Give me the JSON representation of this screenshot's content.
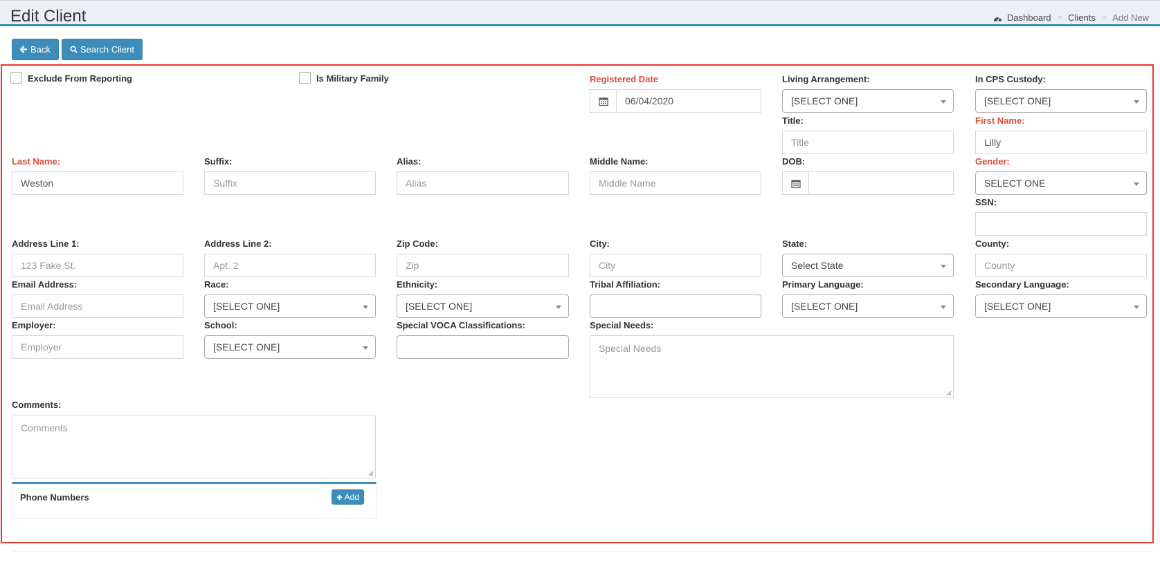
{
  "header": {
    "title": "Edit Client",
    "breadcrumb": {
      "home_icon": "dashboard-icon",
      "items": [
        "Dashboard",
        "Clients"
      ],
      "active": "Add New"
    }
  },
  "toolbar": {
    "back_label": "Back",
    "back_icon": "arrow-left-icon",
    "search_label": "Search Client",
    "search_icon": "search-icon"
  },
  "checkboxes": {
    "exclude_from_reporting": "Exclude From Reporting",
    "is_military_family": "Is Military Family"
  },
  "fields": {
    "registered_date": {
      "label": "Registered Date",
      "value": "06/04/2020"
    },
    "living_arrangement": {
      "label": "Living Arrangement:",
      "value": "[SELECT ONE]"
    },
    "in_cps_custody": {
      "label": "In CPS Custody:",
      "value": "[SELECT ONE]"
    },
    "title": {
      "label": "Title:",
      "placeholder": "Title"
    },
    "first_name": {
      "label": "First Name:",
      "value": "Lilly"
    },
    "last_name": {
      "label": "Last Name:",
      "value": "Weston"
    },
    "suffix": {
      "label": "Suffix:",
      "placeholder": "Suffix"
    },
    "alias": {
      "label": "Alias:",
      "placeholder": "Alias"
    },
    "middle_name": {
      "label": "Middle Name:",
      "placeholder": "Middle Name"
    },
    "dob": {
      "label": "DOB:",
      "value": ""
    },
    "gender": {
      "label": "Gender:",
      "value": "SELECT ONE"
    },
    "ssn": {
      "label": "SSN:",
      "value": ""
    },
    "address_line_1": {
      "label": "Address Line 1:",
      "placeholder": "123 Fake St."
    },
    "address_line_2": {
      "label": "Address Line 2:",
      "placeholder": "Apt. 2"
    },
    "zip_code": {
      "label": "Zip Code:",
      "placeholder": "Zip"
    },
    "city": {
      "label": "City:",
      "placeholder": "City"
    },
    "state": {
      "label": "State:",
      "value": "Select State"
    },
    "county": {
      "label": "County:",
      "placeholder": "County"
    },
    "email": {
      "label": "Email Address:",
      "placeholder": "Email Address"
    },
    "race": {
      "label": "Race:",
      "value": "[SELECT ONE]"
    },
    "ethnicity": {
      "label": "Ethnicity:",
      "value": "[SELECT ONE]"
    },
    "tribal_affiliation": {
      "label": "Tribal Affiliation:",
      "value": ""
    },
    "primary_language": {
      "label": "Primary Language:",
      "value": "[SELECT ONE]"
    },
    "secondary_language": {
      "label": "Secondary Language:",
      "value": "[SELECT ONE]"
    },
    "employer": {
      "label": "Employer:",
      "placeholder": "Employer"
    },
    "school": {
      "label": "School:",
      "value": "[SELECT ONE]"
    },
    "special_voca": {
      "label": "Special VOCA Classifications:",
      "value": ""
    },
    "special_needs": {
      "label": "Special Needs:",
      "placeholder": "Special Needs"
    },
    "comments": {
      "label": "Comments:",
      "placeholder": "Comments"
    }
  },
  "phone_numbers": {
    "title": "Phone Numbers",
    "add_label": "Add",
    "add_icon": "plus-icon"
  },
  "colors": {
    "primary": "#3c8dbc",
    "required_label": "#dd4b39",
    "highlight_border": "#e53935"
  }
}
